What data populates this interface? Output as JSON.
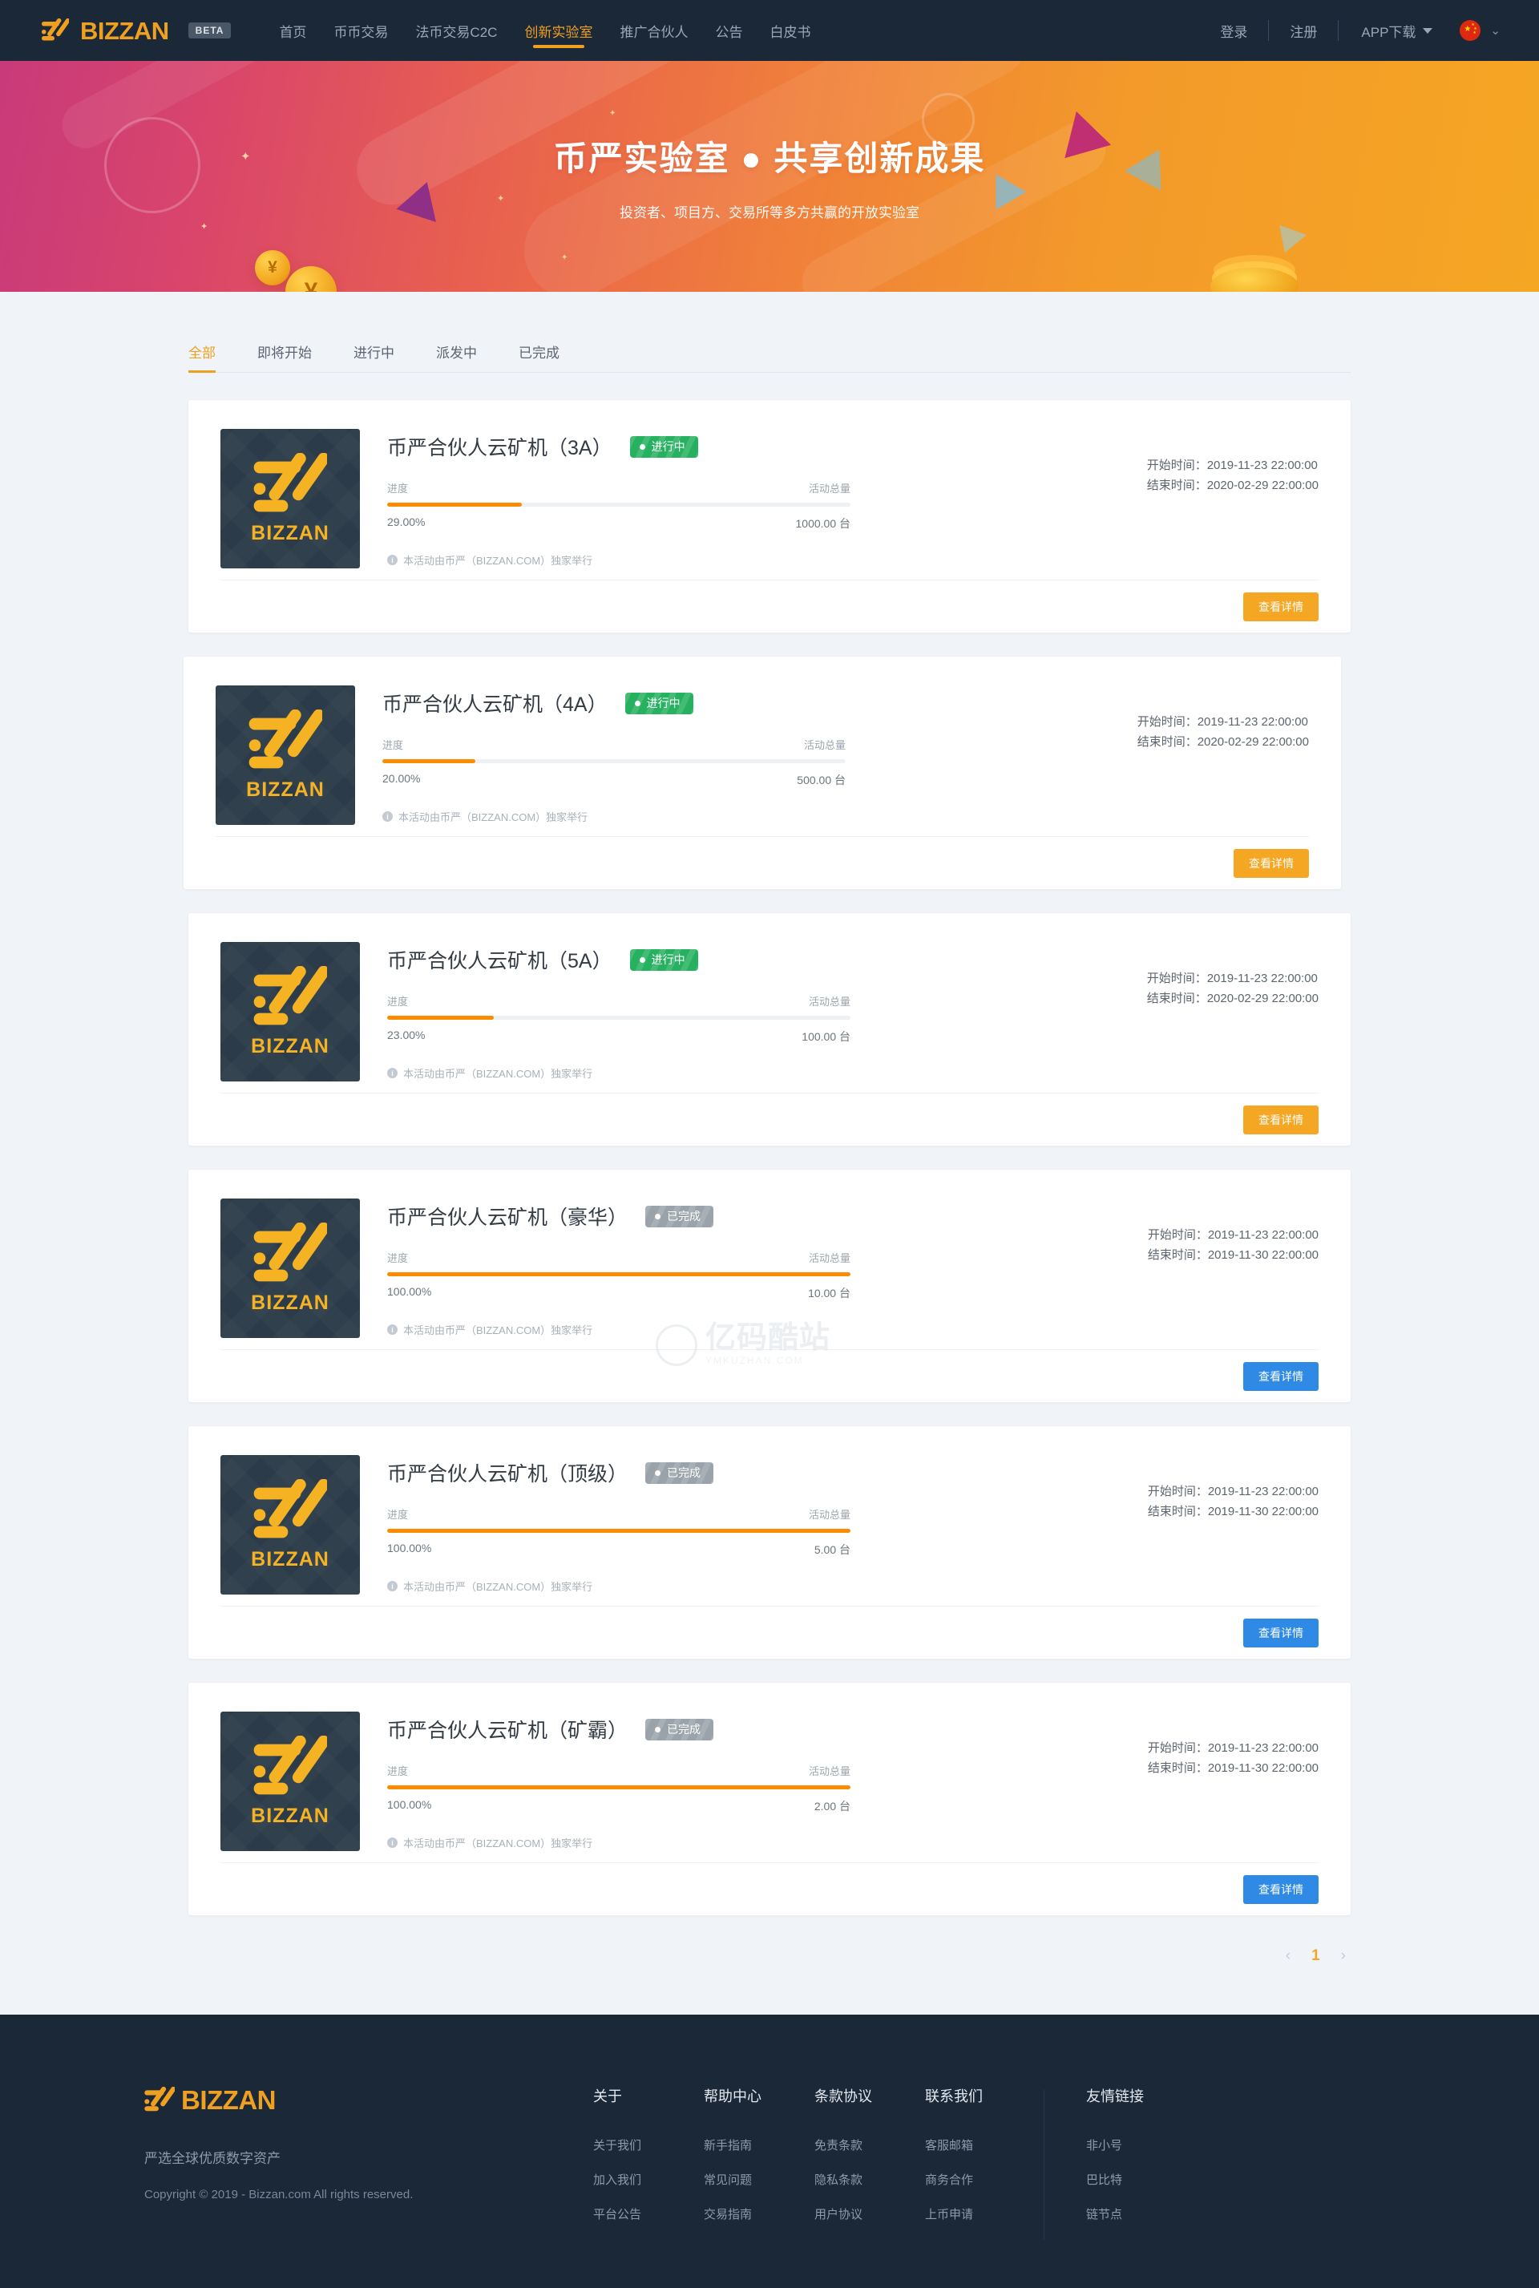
{
  "header": {
    "brand_word": "BIZZAN",
    "beta": "BETA",
    "nav": [
      {
        "label": "首页",
        "active": false
      },
      {
        "label": "币币交易",
        "active": false
      },
      {
        "label": "法币交易C2C",
        "active": false
      },
      {
        "label": "创新实验室",
        "active": true
      },
      {
        "label": "推广合伙人",
        "active": false
      },
      {
        "label": "公告",
        "active": false
      },
      {
        "label": "白皮书",
        "active": false
      }
    ],
    "login": "登录",
    "register": "注册",
    "app_download": "APP下载",
    "lang_flag": "cn-flag-icon"
  },
  "hero": {
    "title": "币严实验室 ● 共享创新成果",
    "subtitle": "投资者、项目方、交易所等多方共赢的开放实验室"
  },
  "tabs": [
    {
      "label": "全部",
      "active": true
    },
    {
      "label": "即将开始",
      "active": false
    },
    {
      "label": "进行中",
      "active": false
    },
    {
      "label": "派发中",
      "active": false
    },
    {
      "label": "已完成",
      "active": false
    }
  ],
  "labels": {
    "progress": "进度",
    "total": "活动总量",
    "start_time": "开始时间：",
    "end_time": "结束时间：",
    "note": "本活动由币严（BIZZAN.COM）独家举行",
    "detail_button": "查看详情",
    "thumb_word": "BIZZAN"
  },
  "cards": [
    {
      "title": "币严合伙人云矿机（3A）",
      "status": "进行中",
      "status_kind": "running",
      "progress_text": "29.00%",
      "progress_value": 29,
      "total": "1000.00 台",
      "start_time": "2019-11-23 22:00:00",
      "end_time": "2020-02-29 22:00:00",
      "button_color": "orange"
    },
    {
      "title": "币严合伙人云矿机（4A）",
      "status": "进行中",
      "status_kind": "running",
      "progress_text": "20.00%",
      "progress_value": 20,
      "total": "500.00 台",
      "start_time": "2019-11-23 22:00:00",
      "end_time": "2020-02-29 22:00:00",
      "button_color": "orange"
    },
    {
      "title": "币严合伙人云矿机（5A）",
      "status": "进行中",
      "status_kind": "running",
      "progress_text": "23.00%",
      "progress_value": 23,
      "total": "100.00 台",
      "start_time": "2019-11-23 22:00:00",
      "end_time": "2020-02-29 22:00:00",
      "button_color": "orange"
    },
    {
      "title": "币严合伙人云矿机（豪华）",
      "status": "已完成",
      "status_kind": "done",
      "progress_text": "100.00%",
      "progress_value": 100,
      "total": "10.00 台",
      "start_time": "2019-11-23 22:00:00",
      "end_time": "2019-11-30 22:00:00",
      "button_color": "blue"
    },
    {
      "title": "币严合伙人云矿机（顶级）",
      "status": "已完成",
      "status_kind": "done",
      "progress_text": "100.00%",
      "progress_value": 100,
      "total": "5.00 台",
      "start_time": "2019-11-23 22:00:00",
      "end_time": "2019-11-30 22:00:00",
      "button_color": "blue"
    },
    {
      "title": "币严合伙人云矿机（矿霸）",
      "status": "已完成",
      "status_kind": "done",
      "progress_text": "100.00%",
      "progress_value": 100,
      "total": "2.00 台",
      "start_time": "2019-11-23 22:00:00",
      "end_time": "2019-11-30 22:00:00",
      "button_color": "blue"
    }
  ],
  "watermark": {
    "text": "亿码酷站",
    "sub": "YMKUZHAN.COM"
  },
  "pagination": {
    "prev": "‹",
    "current": "1",
    "next": "›"
  },
  "footer": {
    "brand_word": "BIZZAN",
    "slogan": "严选全球优质数字资产",
    "copyright": "Copyright © 2019 - Bizzan.com All rights reserved.",
    "columns": [
      {
        "title": "关于",
        "links": [
          "关于我们",
          "加入我们",
          "平台公告"
        ]
      },
      {
        "title": "帮助中心",
        "links": [
          "新手指南",
          "常见问题",
          "交易指南"
        ]
      },
      {
        "title": "条款协议",
        "links": [
          "免责条款",
          "隐私条款",
          "用户协议"
        ]
      },
      {
        "title": "联系我们",
        "links": [
          "客服邮箱",
          "商务合作",
          "上币申请"
        ]
      },
      {
        "title": "友情链接",
        "links": [
          "非小号",
          "巴比特",
          "链节点"
        ]
      }
    ]
  }
}
